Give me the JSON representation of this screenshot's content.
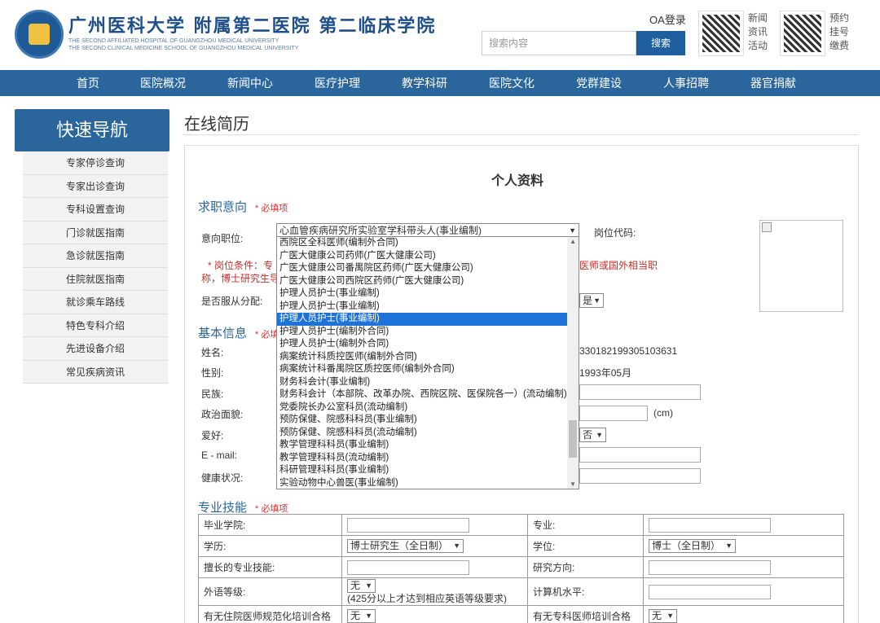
{
  "header": {
    "school_name": "广州医科大学 附属第二医院 第二临床学院",
    "school_en_1": "THE SECOND AFFILIATED HOSPITAL OF GUANGZHOU MEDICAL UNIVERSITY",
    "school_en_2": "THE SECOND CLINICAL MEDICINE SCHOOL OF GUANGZHOU MEDICAL UNIVERSITY",
    "oa_login": "OA登录",
    "search_placeholder": "搜索内容",
    "search_button": "搜索",
    "qr1_text": "新闻\n资讯\n活动",
    "qr2_text": "预约\n挂号\n缴费"
  },
  "nav": [
    "首页",
    "医院概况",
    "新闻中心",
    "医疗护理",
    "教学科研",
    "医院文化",
    "党群建设",
    "人事招聘",
    "器官捐献"
  ],
  "sidebar": {
    "title": "快速导航",
    "items": [
      "专家停诊查询",
      "专家出诊查询",
      "专科设置查询",
      "门诊就医指南",
      "急诊就医指南",
      "住院就医指南",
      "就诊乘车路线",
      "特色专科介绍",
      "先进设备介绍",
      "常见疾病资讯"
    ]
  },
  "main": {
    "page_title": "在线简历",
    "section_title": "个人资料",
    "required": "* 必填项",
    "job_intent": {
      "heading": "求职意向",
      "position_label": "意向职位:",
      "position_value": "心血管疾病研究所实验室学科带头人(事业编制)",
      "code_label": "岗位代码:",
      "condition_left": "* 岗位条件：专",
      "condition_left2": "称，博士研究生导",
      "condition_right": "医师或国外相当职",
      "obey_label": "是否服从分配:",
      "obey_value": "是"
    },
    "basic": {
      "heading": "基本信息",
      "req_short": "* 必填",
      "name_label": "姓名:",
      "gender_label": "性别:",
      "ethnic_label": "民族:",
      "political_label": "政治面貌:",
      "hobby_label": "爱好:",
      "email_label": "E - mail:",
      "health_label": "健康状况:",
      "id_value": "330182199305103631",
      "birth_value": "1993年05月",
      "height_unit": "(cm)",
      "married_value": "否"
    },
    "dropdown": {
      "options": [
        "西院区全科医师(编制外合同)",
        "广医大健康公司药师(广医大健康公司)",
        "广医大健康公司番禺院区药师(广医大健康公司)",
        "广医大健康公司西院区药师(广医大健康公司)",
        "护理人员护士(事业编制)",
        "护理人员护士(事业编制)",
        "护理人员护士(事业编制)",
        "护理人员护士(编制外合同)",
        "护理人员护士(编制外合同)",
        "病案统计科质控医师(编制外合同)",
        "病案统计科番禺院区质控医师(编制外合同)",
        "财务科会计(事业编制)",
        "财务科会计（本部院、改革办院、西院区院、医保院各一）(流动编制)",
        "党委院长办公室科员(流动编制)",
        "预防保健、院感科科员(事业编制)",
        "预防保健、院感科科员(流动编制)",
        "教学管理科科员(事业编制)",
        "教学管理科科员(流动编制)",
        "科研管理科科员(事业编制)",
        "实验动物中心兽医(事业编制)"
      ],
      "selected_index": 6
    },
    "skills": {
      "heading": "专业技能",
      "graduate_label": "毕业学院:",
      "major_label": "专业:",
      "education_label": "学历:",
      "education_value": "博士研究生（全日制）",
      "degree_label": "学位:",
      "degree_value": "博士（全日制）",
      "specialty_label": "擅长的专业技能:",
      "research_label": "研究方向:",
      "english_label": "外语等级:",
      "english_value": "无",
      "english_note": "(425分以上才达到相应英语等级要求)",
      "computer_label": "计算机水平:",
      "resident_label": "有无住院医师规范化培训合格",
      "resident_value": "无",
      "specialist_label": "有无专科医师培训合格",
      "specialist_value": "无"
    }
  }
}
